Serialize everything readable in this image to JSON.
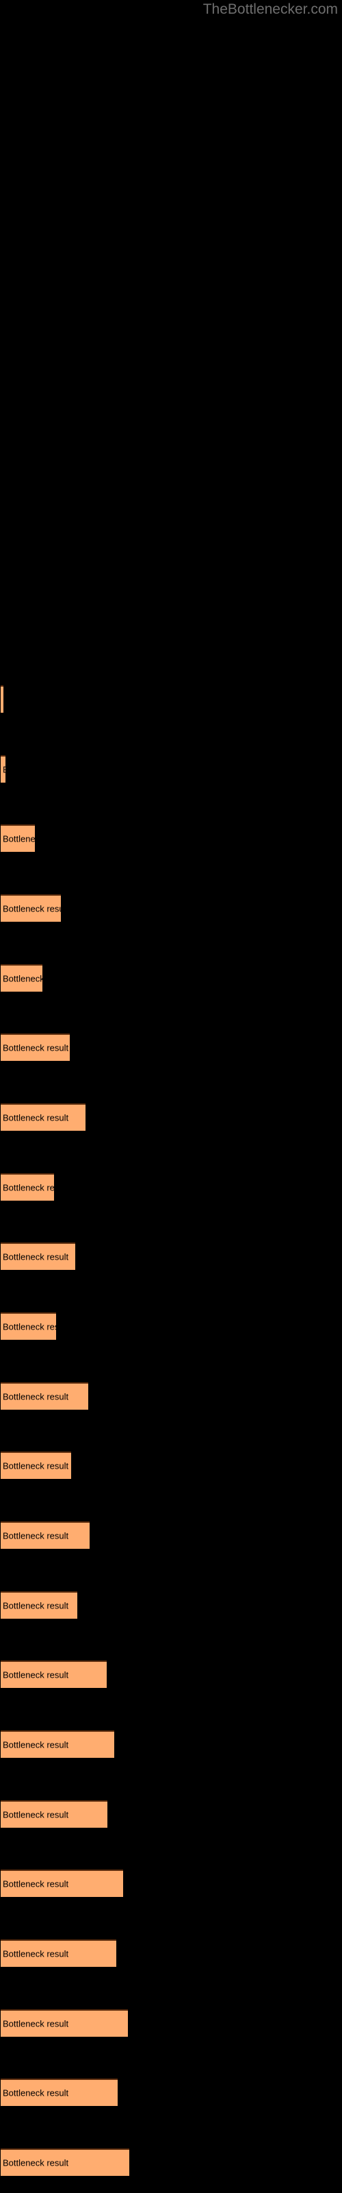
{
  "watermark": {
    "text": "TheBottlenecker.com",
    "color": "#6e6e6e"
  },
  "colors": {
    "background": "#000000",
    "bar_fill": "#ffad70",
    "bar_border_top": "#5c2d0e",
    "bar_text": "#000000"
  },
  "bar_label_text": "Bottleneck result",
  "chart_data": {
    "type": "bar",
    "orientation": "horizontal",
    "title": "",
    "subtitle": "",
    "xlabel": "",
    "ylabel": "",
    "grid": false,
    "legend": null,
    "annotations": [
      "TheBottlenecker.com"
    ],
    "categories": [
      "Bottleneck result",
      "Bottleneck result",
      "Bottleneck result",
      "Bottleneck result",
      "Bottleneck result",
      "Bottleneck result",
      "Bottleneck result",
      "Bottleneck result",
      "Bottleneck result",
      "Bottleneck result",
      "Bottleneck result",
      "Bottleneck result",
      "Bottleneck result",
      "Bottleneck result",
      "Bottleneck result",
      "Bottleneck result",
      "Bottleneck result",
      "Bottleneck result",
      "Bottleneck result",
      "Bottleneck result",
      "Bottleneck result",
      "Bottleneck result"
    ],
    "values": [
      4,
      7,
      50,
      88,
      61,
      101,
      124,
      78,
      109,
      81,
      128,
      103,
      130,
      112,
      155,
      166,
      156,
      179,
      169,
      186,
      171,
      188
    ],
    "xlim": [
      0,
      500
    ],
    "bars": [
      {
        "index": 0,
        "y": 1000,
        "width": 4,
        "height": 40,
        "label": "Bottleneck result"
      },
      {
        "index": 1,
        "y": 1175,
        "width": 7,
        "height": 40,
        "label": "Bottleneck result"
      },
      {
        "index": 2,
        "y": 1262,
        "width": 50,
        "height": 40,
        "label": "Bottleneck result"
      },
      {
        "index": 3,
        "y": 1348,
        "width": 88,
        "height": 40,
        "label": "Bottleneck result"
      },
      {
        "index": 4,
        "y": 1435,
        "width": 61,
        "height": 40,
        "label": "Bottleneck result"
      },
      {
        "index": 5,
        "y": 1521,
        "width": 101,
        "height": 40,
        "label": "Bottleneck result"
      },
      {
        "index": 6,
        "y": 1608,
        "width": 124,
        "height": 40,
        "label": "Bottleneck result"
      },
      {
        "index": 7,
        "y": 1694,
        "width": 78,
        "height": 40,
        "label": "Bottleneck result"
      },
      {
        "index": 8,
        "y": 1781,
        "width": 109,
        "height": 40,
        "label": "Bottleneck result"
      },
      {
        "index": 9,
        "y": 1867,
        "width": 81,
        "height": 40,
        "label": "Bottleneck result"
      },
      {
        "index": 10,
        "y": 1954,
        "width": 128,
        "height": 40,
        "label": "Bottleneck result"
      },
      {
        "index": 11,
        "y": 2040,
        "width": 103,
        "height": 40,
        "label": "Bottleneck result"
      },
      {
        "index": 12,
        "y": 2127,
        "width": 130,
        "height": 40,
        "label": "Bottleneck result"
      },
      {
        "index": 13,
        "y": 2213,
        "width": 112,
        "height": 40,
        "label": "Bottleneck result"
      },
      {
        "index": 14,
        "y": 2268,
        "width": 155,
        "height": 40,
        "label": "Bottleneck result"
      },
      {
        "index": 15,
        "y": 2355,
        "width": 166,
        "height": 40,
        "label": "Bottleneck result"
      },
      {
        "index": 16,
        "y": 2441,
        "width": 156,
        "height": 40,
        "label": "Bottleneck result"
      },
      {
        "index": 17,
        "y": 2528,
        "width": 179,
        "height": 40,
        "label": "Bottleneck result"
      },
      {
        "index": 18,
        "y": 2614,
        "width": 169,
        "height": 40,
        "label": "Bottleneck result"
      },
      {
        "index": 19,
        "y": 2701,
        "width": 186,
        "height": 40,
        "label": "Bottleneck result"
      },
      {
        "index": 20,
        "y": 2787,
        "width": 171,
        "height": 40,
        "label": "Bottleneck result"
      },
      {
        "index": 21,
        "y": 2874,
        "width": 188,
        "height": 40,
        "label": "Bottleneck result"
      }
    ]
  }
}
